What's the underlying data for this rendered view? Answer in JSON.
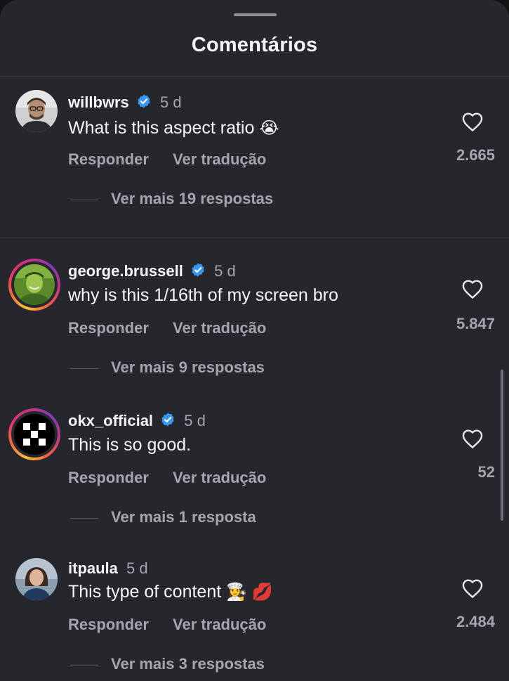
{
  "sheet": {
    "title": "Comentários"
  },
  "comments": [
    {
      "username": "willbwrs",
      "verified": true,
      "time": "5 d",
      "text": "What is this aspect ratio",
      "emoji": "😭",
      "reply_label": "Responder",
      "translate_label": "Ver tradução",
      "more_replies": "Ver mais 19 respostas",
      "likes": "2.665",
      "story_ring": false
    },
    {
      "username": "george.brussell",
      "verified": true,
      "time": "5 d",
      "text": "why is this 1/16th of my screen bro",
      "emoji": "",
      "reply_label": "Responder",
      "translate_label": "Ver tradução",
      "more_replies": "Ver mais 9 respostas",
      "likes": "5.847",
      "story_ring": true
    },
    {
      "username": "okx_official",
      "verified": true,
      "time": "5 d",
      "text": "This is so good.",
      "emoji": "",
      "reply_label": "Responder",
      "translate_label": "Ver tradução",
      "more_replies": "Ver mais 1 resposta",
      "likes": "52",
      "story_ring": true
    },
    {
      "username": "itpaula",
      "verified": false,
      "time": "5 d",
      "text": "This type of content",
      "emoji": "👩‍🍳 💋",
      "reply_label": "Responder",
      "translate_label": "Ver tradução",
      "more_replies": "Ver mais 3 respostas",
      "likes": "2.484",
      "story_ring": false
    }
  ],
  "icons": {
    "heart": "heart-icon",
    "verified": "verified-badge-icon"
  },
  "colors": {
    "background": "#25272c",
    "verified_blue": "#3897f0",
    "muted_text": "#a4a6ad"
  }
}
